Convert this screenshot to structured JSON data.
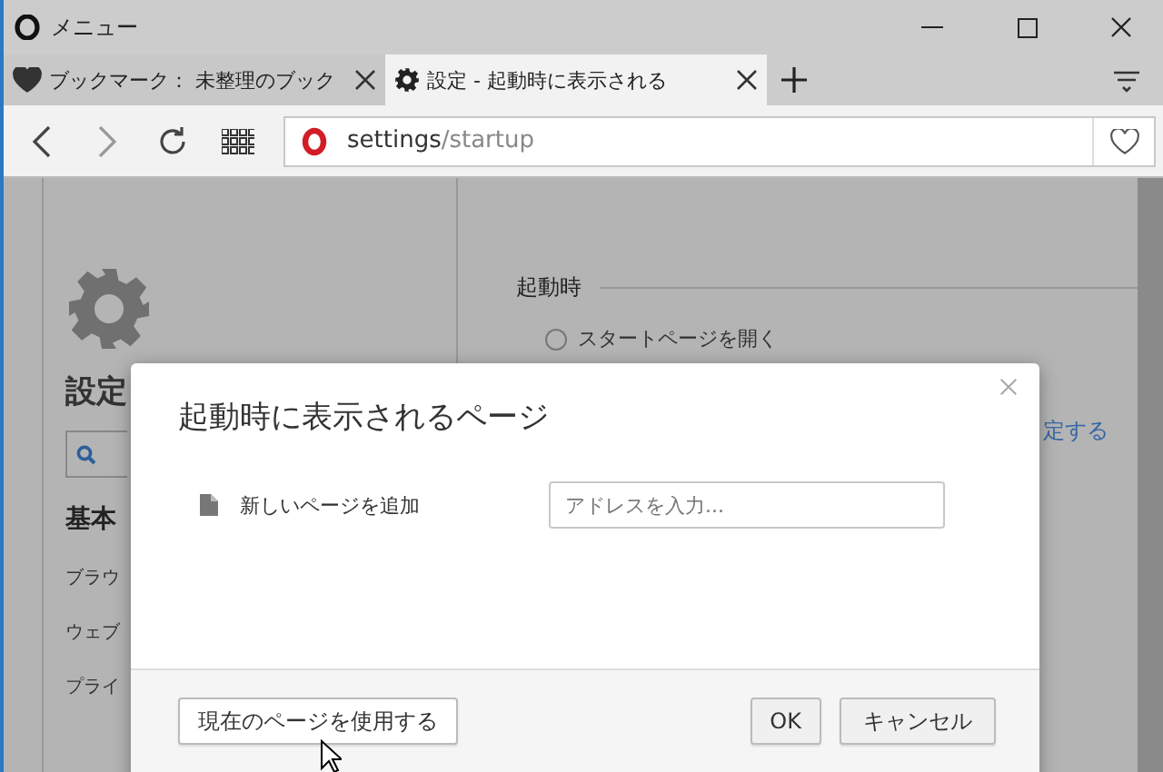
{
  "window": {
    "title": "メニュー"
  },
  "tabs": [
    {
      "label": "ブックマーク： 未整理のブック",
      "kind": "bookmarks",
      "selected": false
    },
    {
      "label": "設定 - 起動時に表示される",
      "kind": "settings",
      "selected": true
    }
  ],
  "address": {
    "host": "settings",
    "path": "/startup"
  },
  "sidebar": {
    "title": "設定",
    "section": "基本",
    "items": [
      "ブラウ",
      "ウェブ",
      "プライ"
    ]
  },
  "main": {
    "section": "起動時",
    "options": [
      {
        "label": "スタートページを開く",
        "selected": false
      }
    ],
    "link": "定する"
  },
  "dialog": {
    "title": "起動時に表示されるページ",
    "rows": [
      {
        "label": "新しいページを追加",
        "placeholder": "アドレスを入力..."
      }
    ],
    "secondary_button": "現在のページを使用する",
    "ok_button": "OK",
    "cancel_button": "キャンセル"
  }
}
